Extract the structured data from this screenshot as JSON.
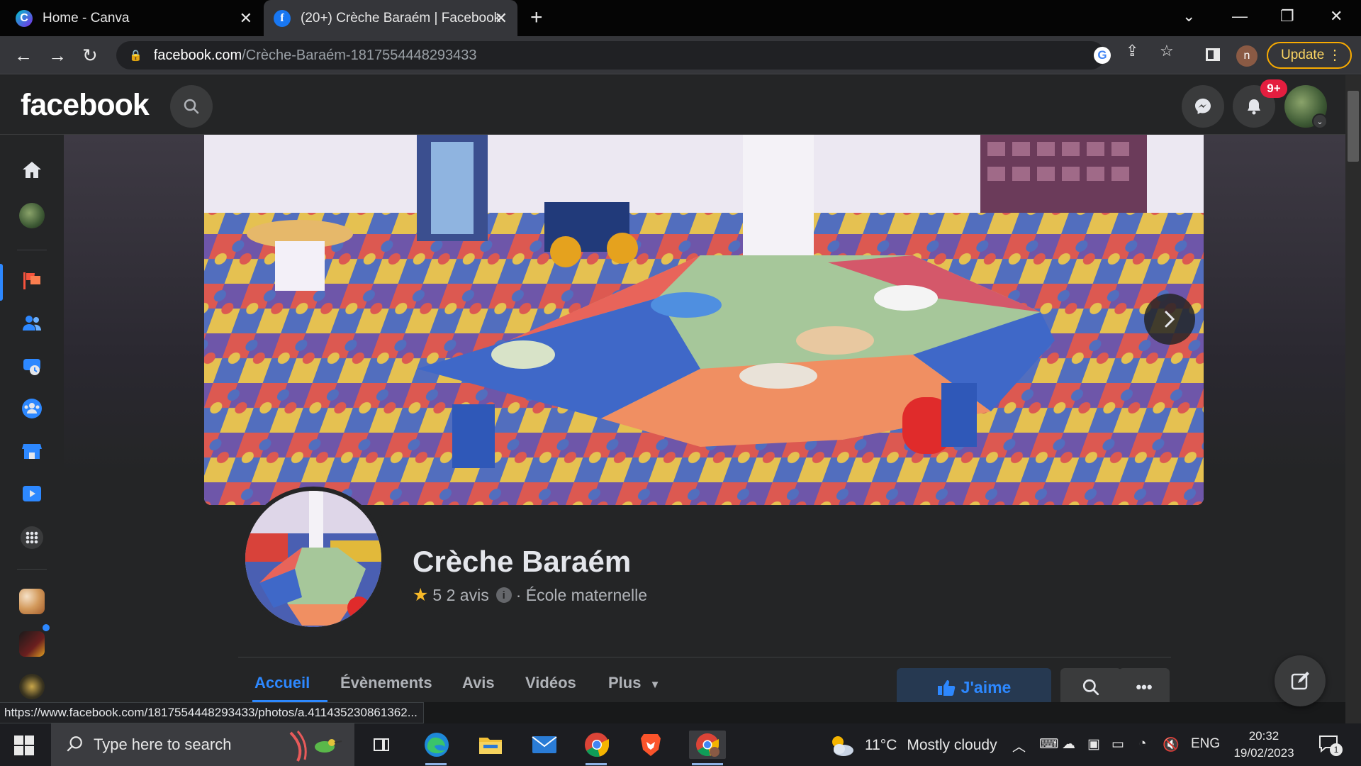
{
  "browser": {
    "tabs": [
      {
        "title": "Home - Canva",
        "favicon": "canva-icon"
      },
      {
        "title": "(20+) Crèche Baraém | Facebook",
        "favicon": "facebook-icon",
        "active": true
      }
    ],
    "url_host": "facebook.com",
    "url_path": "/Crèche-Baraém-1817554448293433",
    "profile_initial": "n",
    "update_label": "Update"
  },
  "facebook": {
    "logo": "facebook",
    "notifications_badge": "9+"
  },
  "page": {
    "name": "Crèche Baraém",
    "rating": "5",
    "reviews": "2 avis",
    "category": "· École maternelle",
    "tabs": [
      "Accueil",
      "Évènements",
      "Avis",
      "Vidéos",
      "Plus"
    ],
    "active_tab": "Accueil",
    "like_label": "J'aime"
  },
  "status_url": "https://www.facebook.com/1817554448293433/photos/a.411435230861362...",
  "taskbar": {
    "search_placeholder": "Type here to search",
    "temperature": "11°C",
    "weather": "Mostly cloudy",
    "language": "ENG",
    "time": "20:32",
    "date": "19/02/2023",
    "notification_count": "1"
  },
  "colors": {
    "facebook_blue": "#2d88ff",
    "badge_red": "#e41e3f",
    "update_amber": "#f9ab00",
    "surface": "#242526"
  }
}
